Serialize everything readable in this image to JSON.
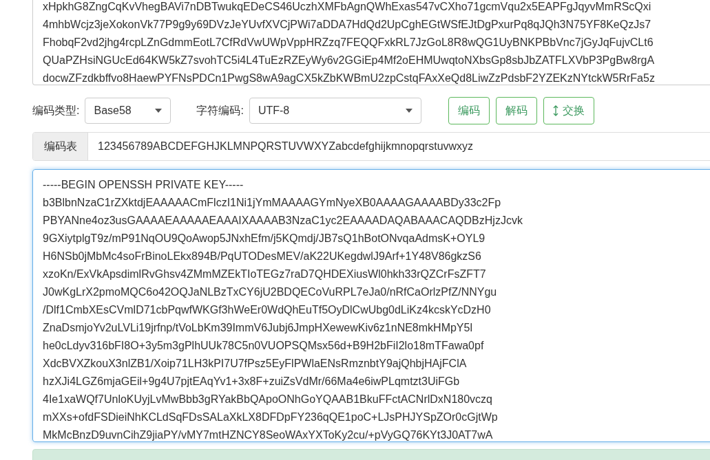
{
  "input_text": {
    "focused": false,
    "lines": [
      "xHpkhG8ZngCqKvVhegBAVi7nDBTwukqEDeCS46UczhXMFbAgnQWhExas547vCXho71gcmVqu2x5EAPFgJqyvMmRScQxi",
      "4mhbWcjz3jeXokonVk77P9g9y69DVzJeYUvfXVCjPWi7aDDA7HdQd2UpCghEGtWSfEJtDgPxurPq8qJQh3N75YF8KeQzJs7",
      "FhobqF2vd2jhg4rcpLZnGdmmEotL7CfRdVwUWpVppHRZzq7FEQQFxkRL7JzGoL8R8wQG1UyBNKPBbVnc7jGyJqFujvCLt6",
      "QUaPZHsiNGUcEd64KW5kZ7svohTC5i4L4TuEzRZEyWy6v2GGiEp4Mf2oEHMUwqtoNXbsGp8sbJbZATFLXVbP3PgBw8rgA",
      "docwZFzdkbffvo8HaewPYFNsPDCn1PwgS8wA9agCX5kZbKWBmU2zpCstqFAxXeQd8LiwZzPdsbF2YZEKzNYtckW5RrFa5z"
    ]
  },
  "encoding_type": {
    "label": "编码类型:",
    "value": "Base58"
  },
  "charset": {
    "label": "字符编码:",
    "value": "UTF-8"
  },
  "buttons": [
    {
      "label": "编码",
      "kind": "plain"
    },
    {
      "label": "解码",
      "kind": "plain"
    },
    {
      "label": "交换",
      "kind": "swap"
    }
  ],
  "alphabet": {
    "label": "编码表",
    "value": "123456789ABCDEFGHJKLMNPQRSTUVWXYZabcdefghijkmnopqrstuvwxyz"
  },
  "output_text": {
    "focused": true,
    "lines": [
      "-----BEGIN OPENSSH PRIVATE KEY-----",
      "b3BlbnNzaC1rZXktdjEAAAAACmFlczI1Ni1jYmMAAAAGYmNyeXB0AAAAGAAAABDy33c2Fp",
      "PBYANne4oz3usGAAAAEAAAAAEAAAIXAAAAB3NzaC1yc2EAAAADAQABAAACAQDBzHjzJcvk",
      "9GXiytplgT9z/mP91NqOU9QoAwop5JNxhEfm/j5KQmdj/JB7sQ1hBotONvqaAdmsK+OYL9",
      "H6NSb0jMbMc4soFrBinoLEkx894B/PqUTODesMEV/aK22UKegdwlJ9Arf+1Y48V86gkzS6",
      "xzoKn/ExVkApsdimlRvGhsv4ZMmMZEkTIoTEGz7raD7QHDEXiusWl0hkh33rQZCrFsZFT7",
      "J0wKgLrX2pmoMQC6o42OQJaNLBzTxCY6jU2BDQECoVuRPL7eJa0/nRfCaOrlzPfZ/NNYgu",
      "/Dlf1CmbXEsCVmlD71cbPqwfWKGf3hWeEr0WdQhEuTf5OyDlCwUbg0dLiKz4kcskYcDzH0",
      "ZnaDsmjoYv2uLVLi19jrfnp/tVoLbKm39ImmV6Jubj6JmpHXewewKiv6z1nNE8mkHMpY5l",
      "he0cLdyv316bFI8O+3y5m3gPlhUUk78C5n0VUOPSQMsx56d+B9H2bFiI2lo18mTFawa0pf",
      "XdcBVXZkouX3nlZB1/Xoip71LH3kPI7U7fPsz5EyFlPWlaENsRmznbtY9ajQhbjHAjFClA",
      "hzXJi4LGZ6mjaGEil+9g4U7pjtEAqYv1+3x8F+zuiZsVdMr/66Ma4e6iwPLqmtzt3UiFGb",
      "4Ie1xaWQf7UnloKUyjLvMwBbb3gRYakBbQApoONhGoYQAAB1BkuFFctACNrlDxN180vczq",
      "mXXs+ofdFSDieiNhKCLdSqFDsSALaXkLX8DFDpFY236qQE1poC+LJsPHJYSpZOr0cGjtWp",
      "MkMcBnzD9uvnCihZ9jiaPY/vMY7mtHZNCY8SeoWAxYXToKy2cu/+pVyGQ76KYt3J0AT7wA"
    ]
  }
}
